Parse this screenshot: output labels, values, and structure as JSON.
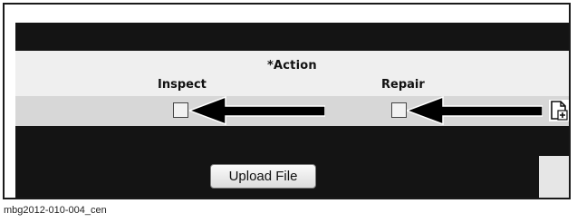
{
  "header": {
    "action_title": "*Action",
    "columns": [
      "Inspect",
      "Repair"
    ]
  },
  "checkboxes": {
    "inspect_checked": false,
    "repair_checked": false
  },
  "icons": {
    "arrow": "left-arrow-pointer",
    "add_document": "add-document-icon"
  },
  "upload": {
    "button_label": "Upload File"
  },
  "caption": "mbg2012-010-004_cen",
  "colors": {
    "dark_band": "#141414",
    "header_row": "#efefef",
    "checkbox_row": "#d7d7d7"
  }
}
